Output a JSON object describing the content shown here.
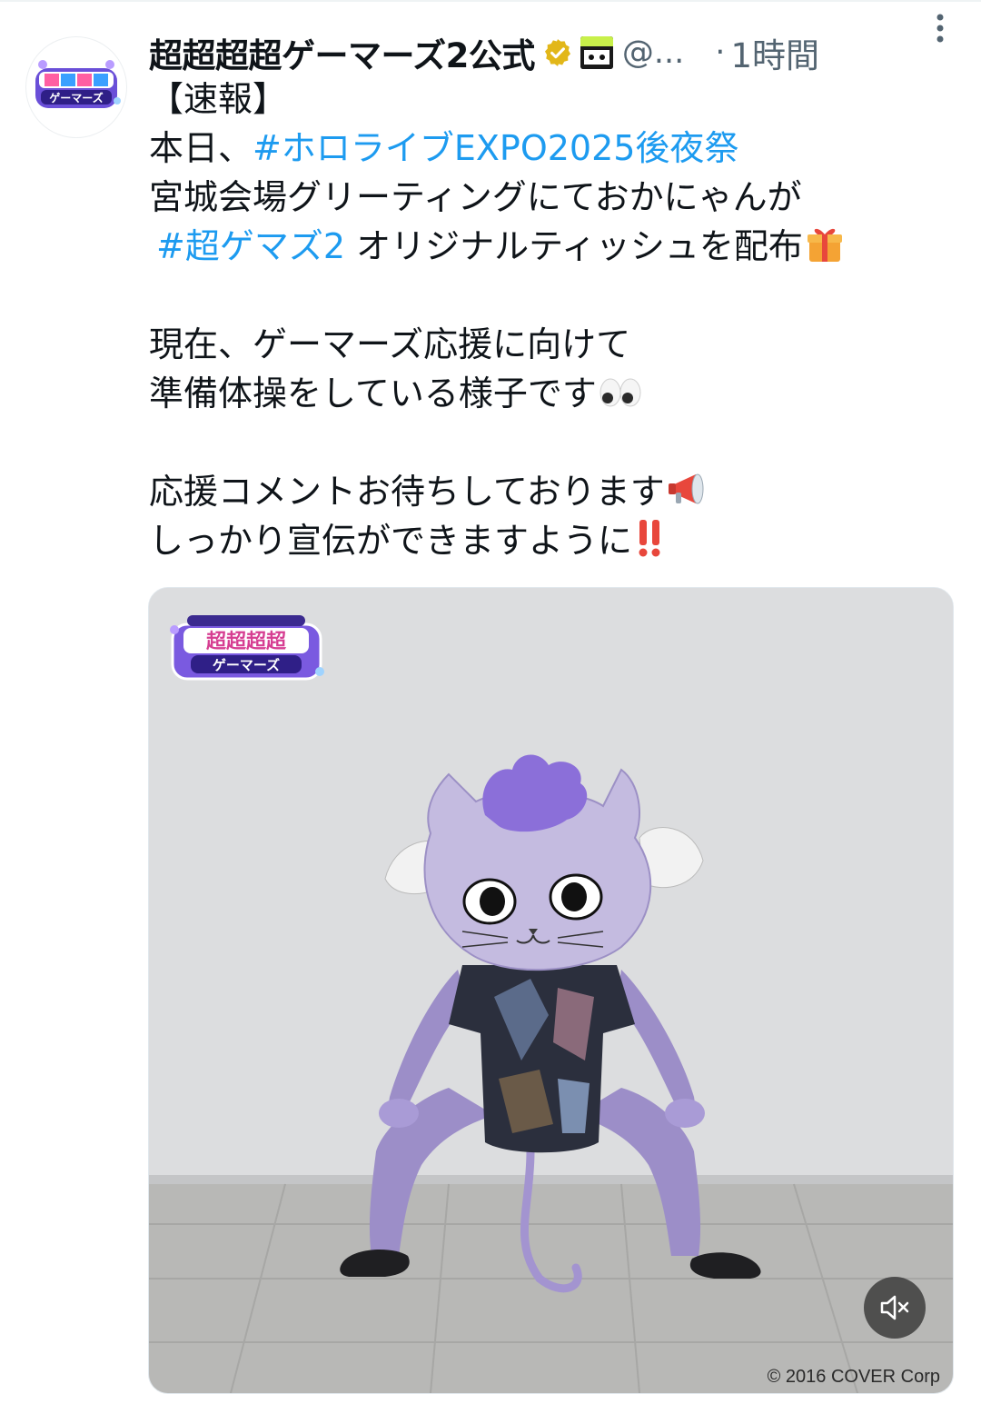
{
  "tweet": {
    "display_name": "超超超超ゲーマーズ2公式",
    "handle": "@...",
    "separator": "·",
    "time": "1時間",
    "logo_text": "ゲーマーズ",
    "text_lines": [
      {
        "plain": "【速報】"
      },
      {
        "prefix": "本日、",
        "hashtag": "#ホロライブEXPO2025後夜祭"
      },
      {
        "plain": "宮城会場グリーティングにておかにゃんが"
      },
      {
        "hashtag2": "#超ゲマズ2",
        "suffix": " オリジナルティッシュを配布"
      },
      {
        "plain2": "現在、ゲーマーズ応援に向けて"
      },
      {
        "plain3": "準備体操をしている様子です"
      },
      {
        "plain4": "応援コメントお待ちしております"
      },
      {
        "plain5": "しっかり宣伝ができますように"
      }
    ],
    "media": {
      "logo_title": "超超超超",
      "logo_sub": "ゲーマーズ",
      "copyright": "© 2016 COVER Corp"
    }
  },
  "icons": {
    "verified": "verified-badge-icon",
    "affiliate": "anime-affiliate-badge-icon",
    "more": "more-vertical-icon",
    "gift": "gift-emoji-icon",
    "eyes": "eyes-emoji-icon",
    "megaphone": "megaphone-emoji-icon",
    "exclamation": "double-exclamation-emoji-icon",
    "mute": "mute-icon"
  },
  "colors": {
    "hashtag": "#1d9bf0",
    "verified": "#e2b719",
    "secondary_text": "#536471"
  }
}
